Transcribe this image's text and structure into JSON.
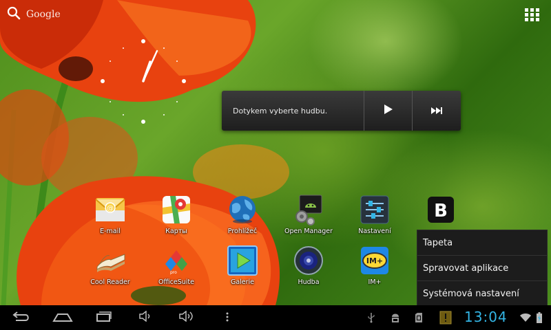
{
  "search": {
    "label": "Google",
    "icon": "search-icon"
  },
  "music_widget": {
    "prompt": "Dotykem vyberte hudbu.",
    "play_icon": "play-icon",
    "next_icon": "skip-next-icon"
  },
  "apps": [
    {
      "label": "E-mail",
      "icon": "email-icon"
    },
    {
      "label": "Карты",
      "icon": "maps-icon"
    },
    {
      "label": "Prohlížeč",
      "icon": "browser-globe-icon"
    },
    {
      "label": "Open Manager",
      "icon": "file-manager-icon"
    },
    {
      "label": "Nastavení",
      "icon": "settings-sliders-icon"
    },
    {
      "label": "Cool Reader",
      "icon": "book-icon"
    },
    {
      "label": "OfficeSuite",
      "icon": "officesuite-icon"
    },
    {
      "label": "Galerie",
      "icon": "gallery-icon"
    },
    {
      "label": "Hudba",
      "icon": "music-speaker-icon"
    },
    {
      "label": "IM+",
      "icon": "im-plus-icon"
    },
    {
      "label": "",
      "icon": "b-app-icon"
    }
  ],
  "context_menu": {
    "items": [
      "Tapeta",
      "Spravovat aplikace",
      "Systémová nastavení"
    ]
  },
  "system_bar": {
    "time": "13:04",
    "nav_icons": [
      "back-icon",
      "home-icon",
      "recent-apps-icon",
      "volume-down-icon",
      "volume-up-icon",
      "overflow-menu-icon"
    ],
    "status_icons": [
      "usb-icon",
      "android-debug-icon",
      "sd-card-icon",
      "warning-icon",
      "wifi-icon",
      "battery-icon"
    ]
  },
  "colors": {
    "clock": "#33b5e5",
    "menu_bg": "#1c1c1c",
    "widget_bg": "#2a2a2a"
  }
}
